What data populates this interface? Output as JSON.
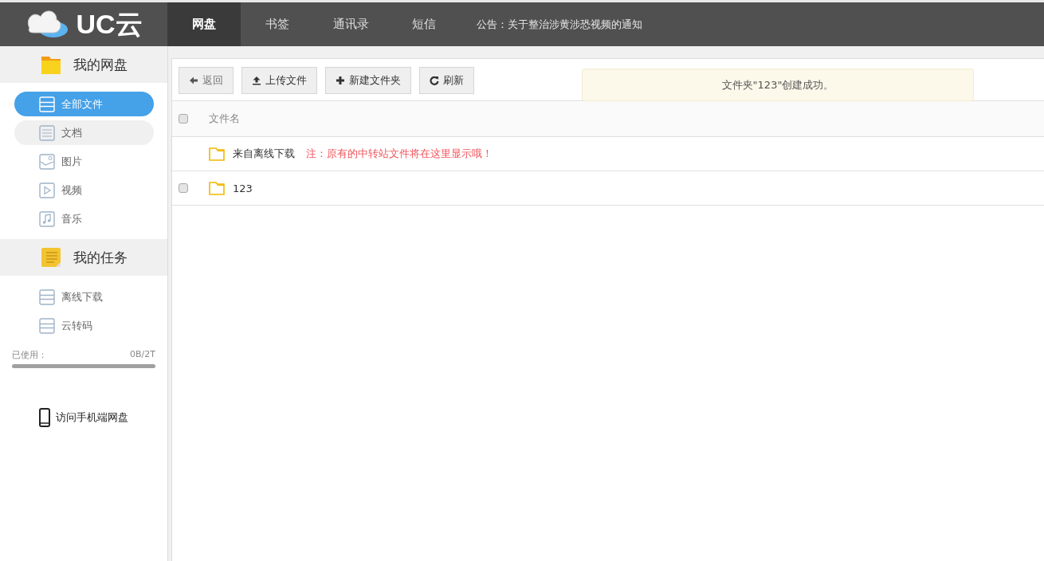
{
  "logo": {
    "text": "UC云"
  },
  "nav": [
    {
      "label": "网盘",
      "selected": true
    },
    {
      "label": "书签",
      "selected": false
    },
    {
      "label": "通讯录",
      "selected": false
    },
    {
      "label": "短信",
      "selected": false
    }
  ],
  "announcement": "公告：关于整治涉黄涉恐视频的通知",
  "sidebar": {
    "sections": [
      {
        "title": "我的网盘",
        "kind": "folder",
        "items": [
          {
            "label": "全部文件",
            "kind": "all",
            "selected": true,
            "hovered": false
          },
          {
            "label": "文档",
            "kind": "doc",
            "selected": false,
            "hovered": true
          },
          {
            "label": "图片",
            "kind": "image",
            "selected": false,
            "hovered": false
          },
          {
            "label": "视频",
            "kind": "video",
            "selected": false,
            "hovered": false
          },
          {
            "label": "音乐",
            "kind": "music",
            "selected": false,
            "hovered": false
          }
        ]
      },
      {
        "title": "我的任务",
        "kind": "notes",
        "items": [
          {
            "label": "离线下载",
            "kind": "list",
            "selected": false,
            "hovered": false
          },
          {
            "label": "云转码",
            "kind": "list",
            "selected": false,
            "hovered": false
          }
        ]
      }
    ],
    "usage": {
      "label": "已使用：",
      "value": "0B/2T",
      "level": 0
    },
    "mobile_link": "访问手机端网盘"
  },
  "toolbar": [
    {
      "label": "返回",
      "kind": "back"
    },
    {
      "label": "上传文件",
      "kind": "upload"
    },
    {
      "label": "新建文件夹",
      "kind": "add"
    },
    {
      "label": "刷新",
      "kind": "refresh"
    }
  ],
  "notice": "文件夹\"123\"创建成功。",
  "table": {
    "header": {
      "label": "文件名",
      "checked": false
    },
    "rows": [
      {
        "kind": "pinned",
        "name": "来自离线下载",
        "note": "注：原有的中转站文件将在这里显示哦！"
      },
      {
        "kind": "folder",
        "name": "123",
        "checked": false
      }
    ]
  }
}
